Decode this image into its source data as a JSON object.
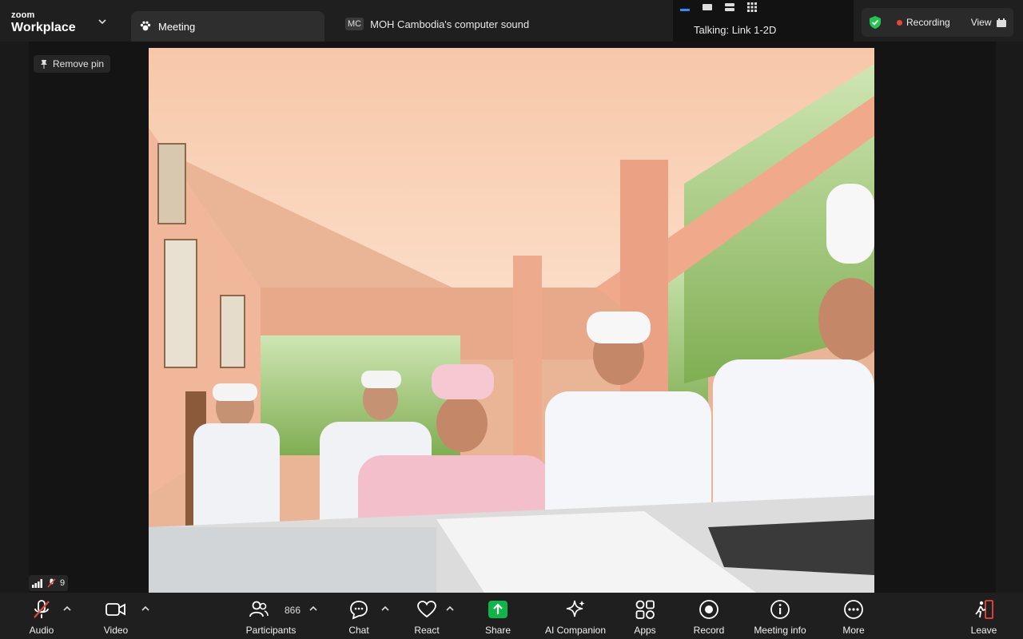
{
  "brand": {
    "line1": "zoom",
    "line2": "Workplace"
  },
  "tabs": {
    "meeting": {
      "label": "Meeting"
    },
    "share": {
      "badge": "MC",
      "label": "MOH Cambodia's computer sound"
    }
  },
  "status": {
    "talking": "Talking: Link 1-2D"
  },
  "recording": {
    "label": "Recording",
    "view_label": "View"
  },
  "stage": {
    "remove_pin": "Remove pin",
    "muted_count": "9"
  },
  "toolbar": {
    "audio": "Audio",
    "video": "Video",
    "participants": "Participants",
    "participants_count": "866",
    "chat": "Chat",
    "react": "React",
    "share": "Share",
    "ai_companion": "AI Companion",
    "apps": "Apps",
    "record": "Record",
    "meeting_info": "Meeting info",
    "more": "More",
    "leave": "Leave"
  },
  "colors": {
    "accent_blue": "#2d8cff",
    "share_green": "#10b54a",
    "recording_red": "#e8463c",
    "secure_green": "#23c552",
    "leave_red": "#e8463c"
  },
  "icons": {
    "meeting_tab": "participants-paw-icon",
    "layout": [
      "speaker-view-icon",
      "gallery-1-icon",
      "gallery-2-icon",
      "gallery-grid-icon"
    ],
    "secure": "shield-check-icon",
    "pin": "pin-icon"
  }
}
